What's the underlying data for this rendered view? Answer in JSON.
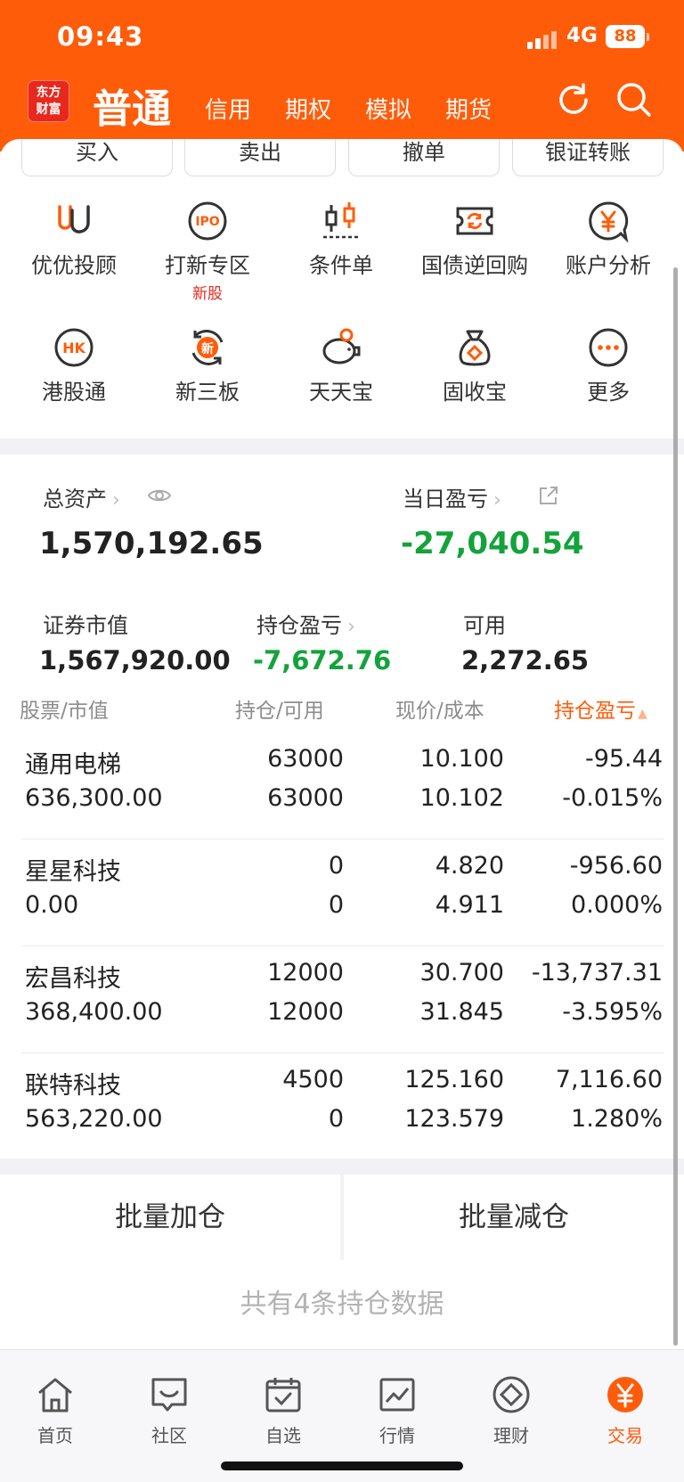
{
  "status_bar": {
    "time": "09:43",
    "network": "4G",
    "battery": "88"
  },
  "header": {
    "logo_top": "东方",
    "logo_bottom": "财富",
    "tabs": [
      {
        "label": "普通",
        "active": true
      },
      {
        "label": "信用"
      },
      {
        "label": "期权"
      },
      {
        "label": "模拟"
      },
      {
        "label": "期货"
      }
    ],
    "icons": [
      "refresh-icon",
      "search-icon"
    ]
  },
  "trade_buttons": [
    "买入",
    "卖出",
    "撤单",
    "银证转账"
  ],
  "grid": [
    {
      "label": "优优投顾",
      "icon": "uu-advisor-icon"
    },
    {
      "label": "打新专区",
      "icon": "ipo-icon",
      "badge": "新股"
    },
    {
      "label": "条件单",
      "icon": "candlestick-icon"
    },
    {
      "label": "国债逆回购",
      "icon": "ticket-cycle-icon"
    },
    {
      "label": "账户分析",
      "icon": "yuan-chat-icon"
    },
    {
      "label": "港股通",
      "icon": "hk-icon"
    },
    {
      "label": "新三板",
      "icon": "xin-icon"
    },
    {
      "label": "天天宝",
      "icon": "piggy-bank-icon"
    },
    {
      "label": "固收宝",
      "icon": "money-bag-icon"
    },
    {
      "label": "更多",
      "icon": "more-icon"
    }
  ],
  "assets": {
    "total_label": "总资产",
    "total_value": "1,570,192.65",
    "daily_pl_label": "当日盈亏",
    "daily_pl_value": "-27,040.54",
    "market_value_label": "证券市值",
    "market_value": "1,567,920.00",
    "position_pl_label": "持仓盈亏",
    "position_pl_value": "-7,672.76",
    "available_label": "可用",
    "available_value": "2,272.65"
  },
  "table": {
    "headers": {
      "stock": "股票",
      "market_value": "市值",
      "position": "持仓",
      "available": "可用",
      "price": "现价",
      "cost": "成本",
      "pl": "持仓盈亏"
    },
    "rows": [
      {
        "name": "通用电梯",
        "market_value": "636,300.00",
        "position": "63000",
        "available": "63000",
        "price": "10.100",
        "cost": "10.102",
        "pl": "-95.44",
        "pl_pct": "-0.015%",
        "trend": "down"
      },
      {
        "name": "星星科技",
        "market_value": "0.00",
        "position": "0",
        "available": "0",
        "price": "4.820",
        "cost": "4.911",
        "pl": "-956.60",
        "pl_pct": "0.000%",
        "trend": "down"
      },
      {
        "name": "宏昌科技",
        "market_value": "368,400.00",
        "position": "12000",
        "available": "12000",
        "price": "30.700",
        "cost": "31.845",
        "pl": "-13,737.31",
        "pl_pct": "-3.595%",
        "trend": "down"
      },
      {
        "name": "联特科技",
        "market_value": "563,220.00",
        "position": "4500",
        "available": "0",
        "price": "125.160",
        "cost": "123.579",
        "pl": "7,116.60",
        "pl_pct": "1.280%",
        "trend": "up"
      }
    ]
  },
  "batch": {
    "add": "批量加仓",
    "reduce": "批量减仓"
  },
  "summary": "共有4条持仓数据",
  "nav": [
    {
      "label": "首页",
      "icon": "home-icon"
    },
    {
      "label": "社区",
      "icon": "community-icon"
    },
    {
      "label": "自选",
      "icon": "watchlist-icon"
    },
    {
      "label": "行情",
      "icon": "market-icon"
    },
    {
      "label": "理财",
      "icon": "wealth-icon"
    },
    {
      "label": "交易",
      "icon": "trade-icon",
      "active": true
    }
  ],
  "colors": {
    "brand": "#ff5c0a",
    "down": "#14a33b",
    "up": "#e8281c"
  }
}
